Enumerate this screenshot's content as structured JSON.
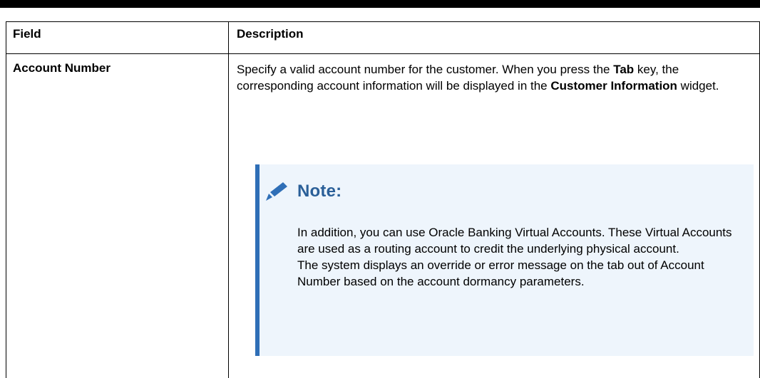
{
  "table": {
    "header": {
      "field": "Field",
      "description": "Description"
    },
    "row": {
      "field": "Account Number",
      "desc_part1": "Specify a valid account number for the customer. When you press the ",
      "desc_bold1": "Tab",
      "desc_part2": " key, the corresponding account information will be displayed in the ",
      "desc_bold2": "Customer Information",
      "desc_part3": " widget."
    }
  },
  "note": {
    "icon": "pencil-icon",
    "title": "Note:",
    "paragraph1": "In addition, you can use Oracle Banking Virtual Accounts. These Virtual Accounts are used as a routing account to credit the underlying physical account.",
    "paragraph2": "The system displays an override or error message on the tab out of Account Number based on the account dormancy parameters."
  },
  "colors": {
    "note_background": "#eef5fc",
    "note_accent": "#2f6fb7",
    "note_title": "#2a5f98"
  }
}
